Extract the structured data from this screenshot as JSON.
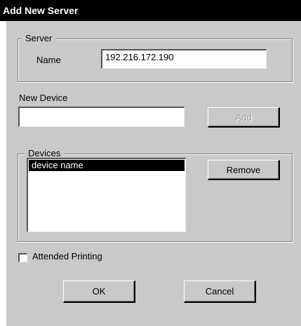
{
  "window": {
    "title": "Add New Server"
  },
  "server_group": {
    "legend": "Server",
    "name_label": "Name",
    "name_value": "192.216.172.190"
  },
  "new_device": {
    "label": "New Device",
    "value": "",
    "add_button": "Add",
    "add_enabled": false
  },
  "devices_group": {
    "legend": "Devices",
    "items": [
      {
        "label": "device name",
        "selected": true
      }
    ],
    "remove_button": "Remove"
  },
  "attended_printing": {
    "label": "Attended Printing",
    "checked": false
  },
  "footer": {
    "ok_button": "OK",
    "cancel_button": "Cancel"
  }
}
